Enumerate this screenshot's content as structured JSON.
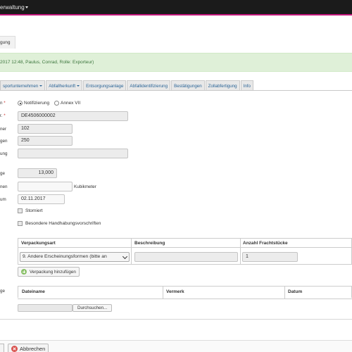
{
  "topbar": {
    "menu_label": "erwaltung"
  },
  "page_tab": {
    "label": "gung"
  },
  "alert": {
    "text": "2017 12:48, Paulus, Conrad, Rolle: Exporteur)"
  },
  "tabs": [
    {
      "label": "sportunternehmen",
      "dropdown": true
    },
    {
      "label": "Abfallherkunft",
      "dropdown": true
    },
    {
      "label": "Entsorgungsanlage",
      "dropdown": false
    },
    {
      "label": "Abfallidentifizierung",
      "dropdown": false
    },
    {
      "label": "Bestätigungen",
      "dropdown": false
    },
    {
      "label": "Zollabfertigung",
      "dropdown": false
    },
    {
      "label": "Info",
      "dropdown": false
    }
  ],
  "form": {
    "type_label": "n",
    "type_required": "*",
    "radio_notifizierung": "Notifizierung",
    "radio_annex": "Annex VII",
    "nr_label": "r.",
    "nr_required": "*",
    "nr_value": "DE4506000002",
    "nummer_label": "ner",
    "nummer_value": "102",
    "anzahl_label": "gen",
    "anzahl_value": "250",
    "bezeichnung_label": "ung",
    "bezeichnung_value": "",
    "menge_label": "ge",
    "menge_value": "13,000",
    "volumen_label": "nen",
    "volumen_value": "",
    "volumen_unit": "Kubikmeter",
    "datum_label": "um",
    "datum_value": "02.11.2017",
    "storniert_label": "Storniert",
    "besondere_label": "Besondere Handhabungsvorschriften"
  },
  "packaging": {
    "headers": [
      "Verpackungsart",
      "Beschreibung",
      "Anzahl Frachtstücke"
    ],
    "row": {
      "art": "9. Andere Erscheinungsformen (bitte an",
      "beschreibung": "",
      "anzahl": "1"
    },
    "add_button": "Verpackung hinzufügen"
  },
  "attachments": {
    "label": "ge",
    "headers": [
      "Dateiname",
      "Vermerk",
      "Datum"
    ],
    "browse_button": "Durchsuchen..."
  },
  "footer": {
    "cancel_label": "Abbrechen"
  }
}
